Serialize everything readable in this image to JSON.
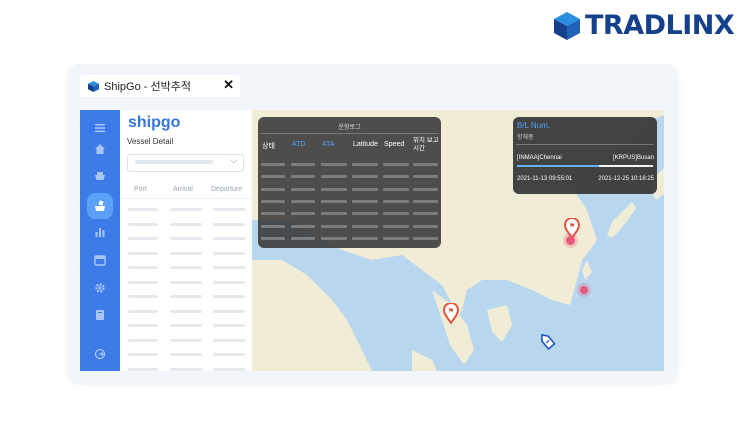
{
  "brand": {
    "logo_text": "TRADLINX",
    "primary_color": "#15418c",
    "accent_color": "#2a8fe0"
  },
  "window": {
    "tab_title": "ShipGo - 선박추적",
    "close_icon": "close-icon"
  },
  "sidebar": {
    "items": [
      {
        "icon": "menu-icon",
        "active": false
      },
      {
        "icon": "home-icon",
        "active": false
      },
      {
        "icon": "ship-icon",
        "active": false
      },
      {
        "icon": "tracking-icon",
        "active": true
      },
      {
        "icon": "chart-icon",
        "active": false
      },
      {
        "icon": "calendar-icon",
        "active": false
      },
      {
        "icon": "gear-icon",
        "active": false
      },
      {
        "icon": "book-icon",
        "active": false
      },
      {
        "icon": "logout-icon",
        "active": false
      }
    ],
    "color": "#3d7ce8"
  },
  "panel": {
    "brand": "shipgo",
    "title": "Vessel Detail",
    "columns": [
      "Port",
      "Arrival",
      "Departure"
    ]
  },
  "voyage_log": {
    "title": "운항로그",
    "columns": [
      "상태",
      "ATD",
      "ATA",
      "Latitude",
      "Speed",
      "위치 보고시간"
    ]
  },
  "bl_card": {
    "title": "B/L Num.",
    "subtitle": "항해중",
    "origin": "[INMAA]Chennai",
    "destination": "[KRPUS]Busan",
    "departure_time": "2021-11-13 09:55:01",
    "arrival_time": "2021-12-25 10:18:25",
    "progress": 0.6
  },
  "map": {
    "markers": [
      "port-pin",
      "port-pin",
      "waypoint",
      "waypoint",
      "vessel"
    ],
    "land_color": "#f0ecd6",
    "sea_color": "#b9d6ef"
  }
}
